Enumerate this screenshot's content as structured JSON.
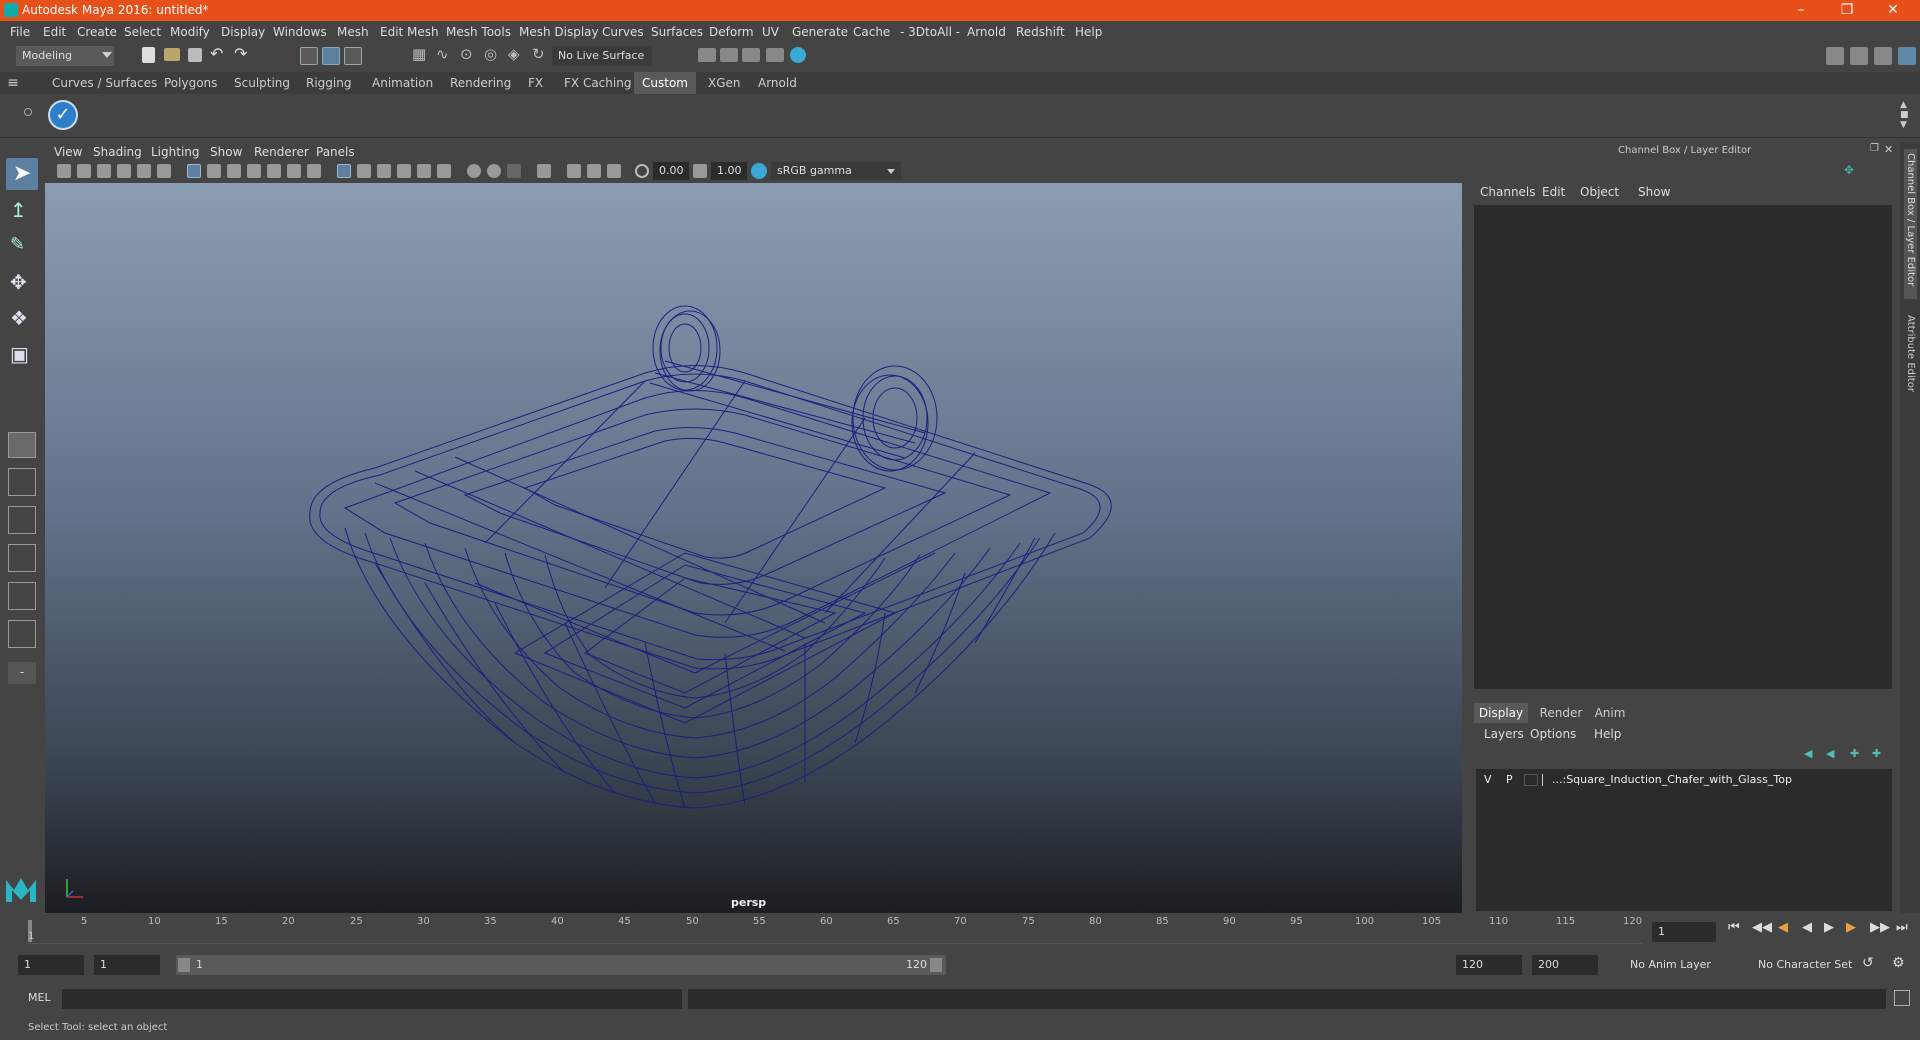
{
  "window": {
    "title": "Autodesk Maya 2016: untitled*"
  },
  "menubar": [
    "File",
    "Edit",
    "Create",
    "Select",
    "Modify",
    "Display",
    "Windows",
    "Mesh",
    "Edit Mesh",
    "Mesh Tools",
    "Mesh Display",
    "Curves",
    "Surfaces",
    "Deform",
    "UV",
    "Generate",
    "Cache",
    "- 3DtoAll -",
    "Arnold",
    "Redshift",
    "Help"
  ],
  "statusline": {
    "mode": "Modeling",
    "live_surface": "No Live Surface"
  },
  "shelf_tabs": [
    "Curves / Surfaces",
    "Polygons",
    "Sculpting",
    "Rigging",
    "Animation",
    "Rendering",
    "FX",
    "FX Caching",
    "Custom",
    "XGen",
    "Arnold"
  ],
  "shelf_active": "Custom",
  "viewport": {
    "menu": [
      "View",
      "Shading",
      "Lighting",
      "Show",
      "Renderer",
      "Panels"
    ],
    "exposure": "0.00",
    "gamma": "1.00",
    "colorspace": "sRGB gamma",
    "camera_label": "persp"
  },
  "channelbox": {
    "title": "Channel Box / Layer Editor",
    "menu": [
      "Channels",
      "Edit",
      "Object",
      "Show"
    ],
    "side_tabs": [
      "Channel Box / Layer Editor",
      "Attribute Editor"
    ],
    "layer_tabs": [
      "Display",
      "Render",
      "Anim"
    ],
    "layer_menu": [
      "Layers",
      "Options",
      "Help"
    ],
    "layer": {
      "v": "V",
      "p": "P",
      "name": "...:Square_Induction_Chafer_with_Glass_Top"
    }
  },
  "timeslider": {
    "ticks": [
      "5",
      "10",
      "15",
      "20",
      "25",
      "30",
      "35",
      "40",
      "45",
      "50",
      "55",
      "60",
      "65",
      "70",
      "75",
      "80",
      "85",
      "90",
      "95",
      "100",
      "105",
      "110",
      "115",
      "120"
    ],
    "start_marker": "1",
    "current_frame": "1"
  },
  "rangeslider": {
    "start": "1",
    "playback_start": "1",
    "bar_start": "1",
    "bar_end": "120",
    "playback_end": "120",
    "end": "200",
    "anim_layer": "No Anim Layer",
    "char_set": "No Character Set"
  },
  "cmdline": {
    "label": "MEL"
  },
  "helpline": {
    "text": "Select Tool: select an object"
  }
}
